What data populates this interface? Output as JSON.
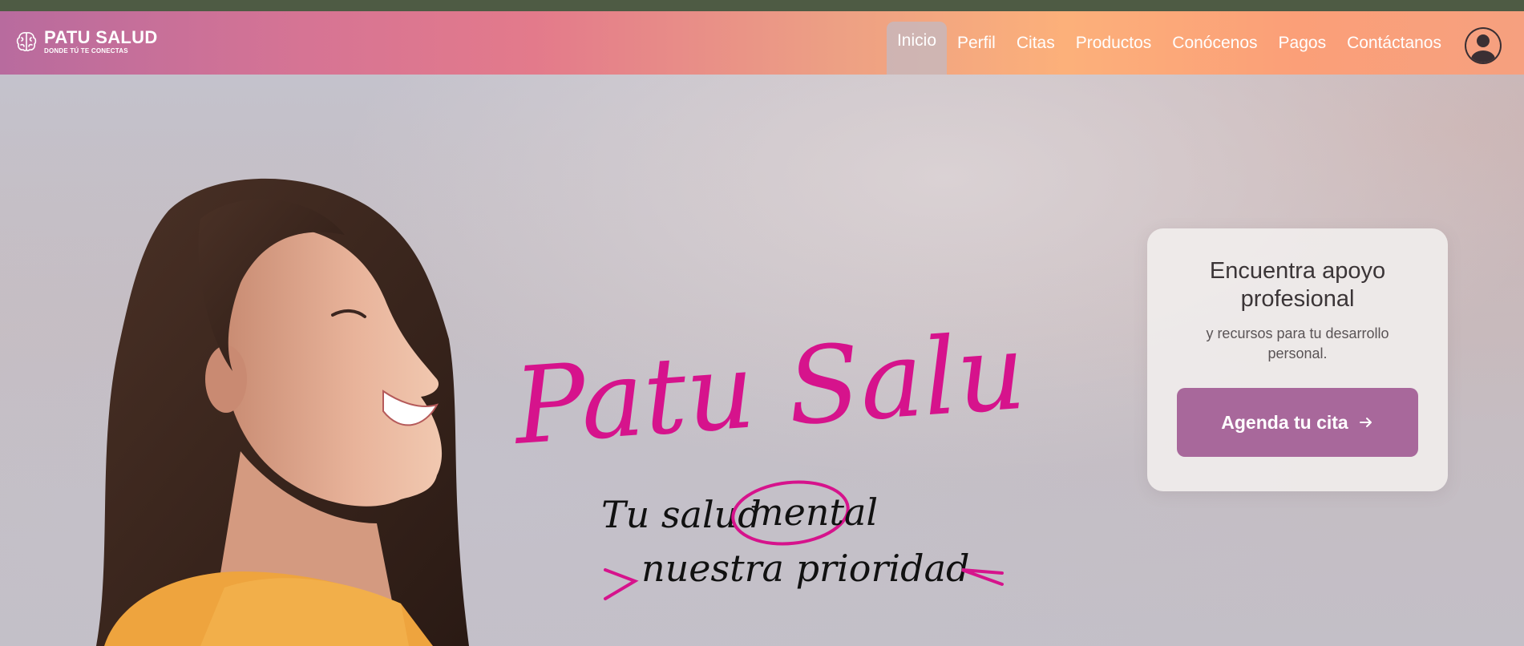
{
  "brand": {
    "name": "PATU SALUD",
    "tagline": "DONDE TÚ TE CONECTAS",
    "icon": "brain-logo-icon"
  },
  "nav": {
    "items": [
      {
        "label": "Inicio",
        "active": true
      },
      {
        "label": "Perfil"
      },
      {
        "label": "Citas"
      },
      {
        "label": "Productos"
      },
      {
        "label": "Conócenos"
      },
      {
        "label": "Pagos"
      },
      {
        "label": "Contáctanos"
      }
    ],
    "avatar_icon": "user-avatar-icon"
  },
  "hero": {
    "script_title": "Patu Salud",
    "slogan_line1_prefix": "Tu salud",
    "slogan_highlight": "mental",
    "slogan_line2": "nuestra prioridad",
    "image": "smiling-woman-photo"
  },
  "card": {
    "title": "Encuentra apoyo profesional",
    "subtitle": "y recursos para tu desarrollo personal.",
    "button_label": "Agenda tu cita",
    "button_icon": "arrow-right-icon"
  },
  "colors": {
    "top_strip": "#4e5b44",
    "nav_gradient_start": "#b86b9e",
    "nav_gradient_end": "#f6a07f",
    "script_pink": "#d6138c",
    "button": "#a8689b"
  }
}
